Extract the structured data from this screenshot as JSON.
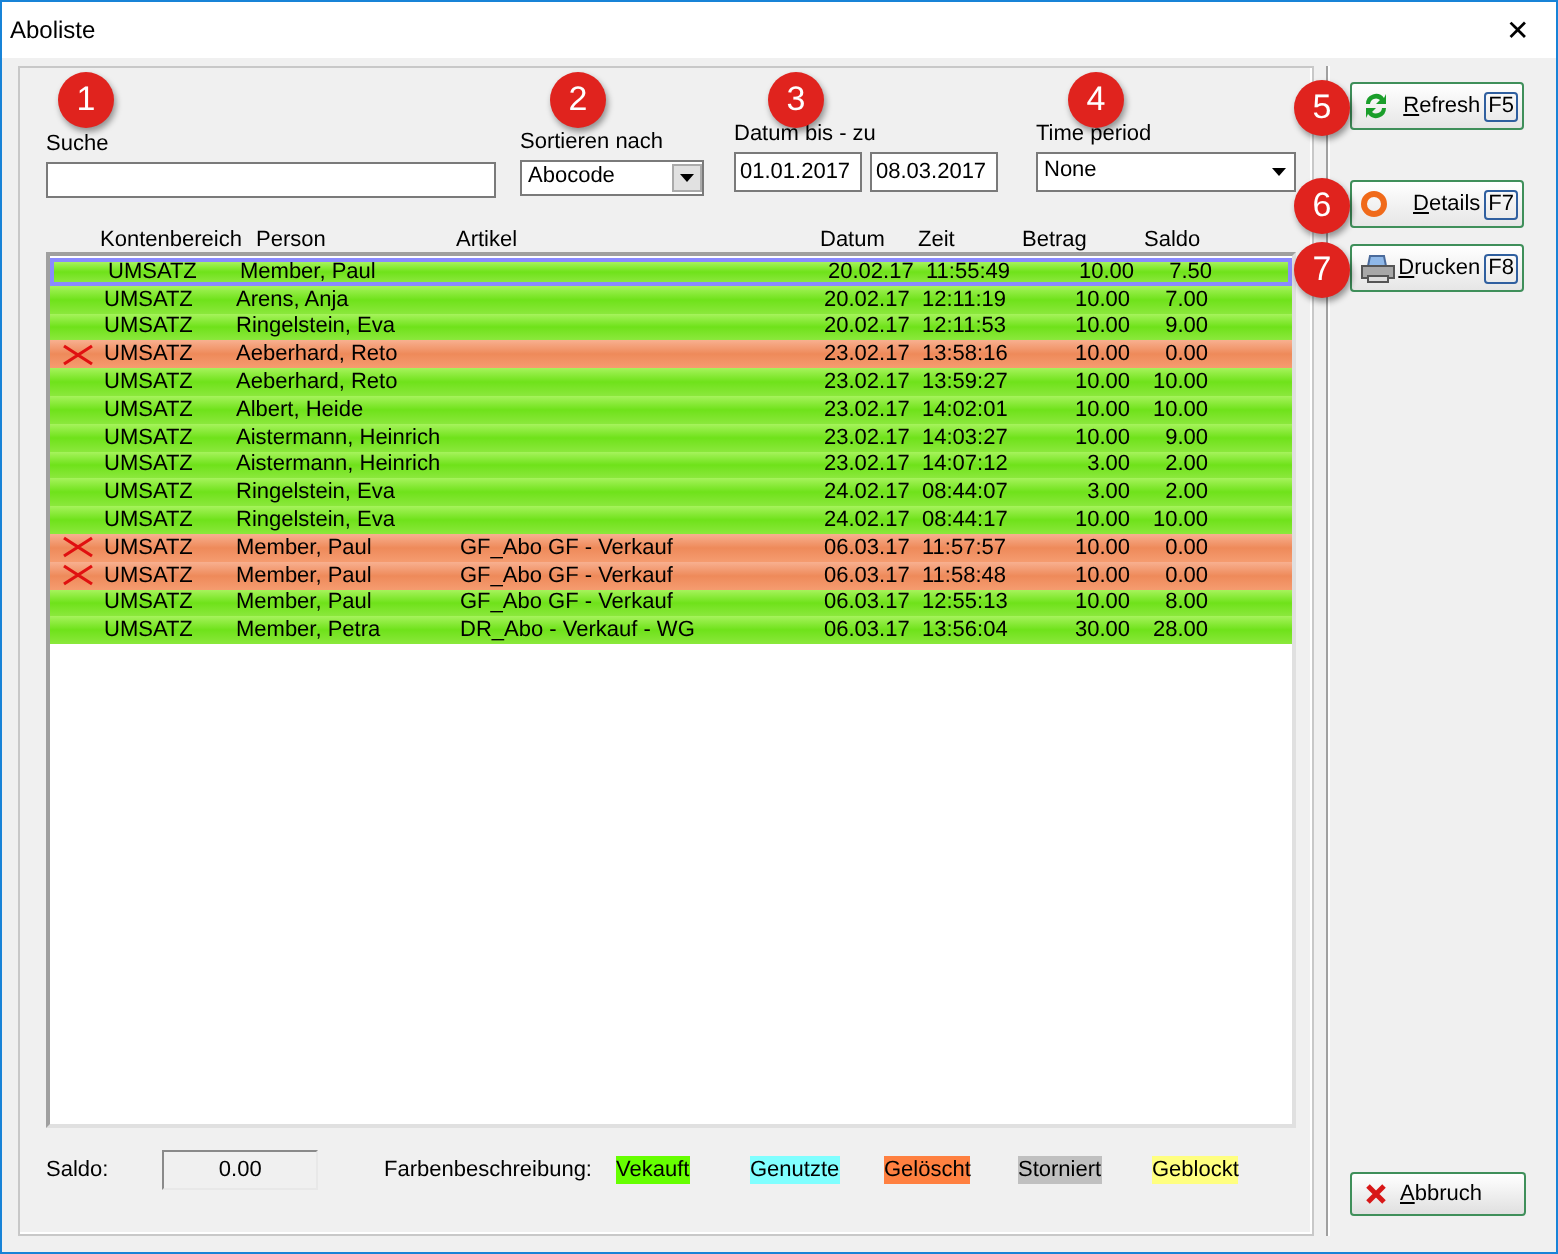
{
  "window": {
    "title": "Aboliste",
    "close": "✕"
  },
  "badges": [
    "1",
    "2",
    "3",
    "4",
    "5",
    "6",
    "7"
  ],
  "search": {
    "label": "Suche"
  },
  "sort": {
    "label": "Sortieren nach",
    "value": "Abocode"
  },
  "date_range": {
    "label": "Datum bis - zu",
    "from": "01.01.2017",
    "to": "08.03.2017"
  },
  "time_period": {
    "label": "Time period",
    "value": "None"
  },
  "table": {
    "columns": [
      "Kontenbereich",
      "Person",
      "Artikel",
      "Datum",
      "Zeit",
      "Betrag",
      "Saldo"
    ],
    "rows": [
      {
        "kind": "sold",
        "selected": true,
        "cells": [
          "UMSATZ",
          "Member, Paul",
          "",
          "20.02.17",
          "11:55:49",
          "10.00",
          "7.50"
        ]
      },
      {
        "kind": "sold",
        "selected": false,
        "cells": [
          "UMSATZ",
          "Arens, Anja",
          "",
          "20.02.17",
          "12:11:19",
          "10.00",
          "7.00"
        ]
      },
      {
        "kind": "sold",
        "selected": false,
        "cells": [
          "UMSATZ",
          "Ringelstein, Eva",
          "",
          "20.02.17",
          "12:11:53",
          "10.00",
          "9.00"
        ]
      },
      {
        "kind": "deleted",
        "selected": false,
        "cells": [
          "UMSATZ",
          "Aeberhard, Reto",
          "",
          "23.02.17",
          "13:58:16",
          "10.00",
          "0.00"
        ]
      },
      {
        "kind": "sold",
        "selected": false,
        "cells": [
          "UMSATZ",
          "Aeberhard, Reto",
          "",
          "23.02.17",
          "13:59:27",
          "10.00",
          "10.00"
        ]
      },
      {
        "kind": "sold",
        "selected": false,
        "cells": [
          "UMSATZ",
          "Albert, Heide",
          "",
          "23.02.17",
          "14:02:01",
          "10.00",
          "10.00"
        ]
      },
      {
        "kind": "sold",
        "selected": false,
        "cells": [
          "UMSATZ",
          "Aistermann, Heinrich",
          "",
          "23.02.17",
          "14:03:27",
          "10.00",
          "9.00"
        ]
      },
      {
        "kind": "sold",
        "selected": false,
        "cells": [
          "UMSATZ",
          "Aistermann, Heinrich",
          "",
          "23.02.17",
          "14:07:12",
          "3.00",
          "2.00"
        ]
      },
      {
        "kind": "sold",
        "selected": false,
        "cells": [
          "UMSATZ",
          "Ringelstein, Eva",
          "",
          "24.02.17",
          "08:44:07",
          "3.00",
          "2.00"
        ]
      },
      {
        "kind": "sold",
        "selected": false,
        "cells": [
          "UMSATZ",
          "Ringelstein, Eva",
          "",
          "24.02.17",
          "08:44:17",
          "10.00",
          "10.00"
        ]
      },
      {
        "kind": "deleted",
        "selected": false,
        "cells": [
          "UMSATZ",
          "Member, Paul",
          "GF_Abo GF - Verkauf",
          "06.03.17",
          "11:57:57",
          "10.00",
          "0.00"
        ]
      },
      {
        "kind": "deleted",
        "selected": false,
        "cells": [
          "UMSATZ",
          "Member, Paul",
          "GF_Abo GF - Verkauf",
          "06.03.17",
          "11:58:48",
          "10.00",
          "0.00"
        ]
      },
      {
        "kind": "sold",
        "selected": false,
        "cells": [
          "UMSATZ",
          "Member, Paul",
          "GF_Abo GF - Verkauf",
          "06.03.17",
          "12:55:13",
          "10.00",
          "8.00"
        ]
      },
      {
        "kind": "sold",
        "selected": false,
        "cells": [
          "UMSATZ",
          "Member, Petra",
          "DR_Abo - Verkauf - WG",
          "06.03.17",
          "13:56:04",
          "30.00",
          "28.00"
        ]
      }
    ]
  },
  "saldo": {
    "label": "Saldo:",
    "value": "0.00"
  },
  "legend": {
    "label": "Farbenbeschreibung:",
    "items": [
      {
        "text": "Vekauft",
        "color": "#66ff00"
      },
      {
        "text": "Genutzte",
        "color": "#80ffff"
      },
      {
        "text": "Gelöscht",
        "color": "#ff8040"
      },
      {
        "text": "Storniert",
        "color": "#c0c0c0"
      },
      {
        "text": "Geblockt",
        "color": "#ffff80"
      }
    ]
  },
  "buttons": [
    {
      "kind": "refresh",
      "label": "Refresh",
      "key": "F5"
    },
    {
      "kind": "details",
      "label": "Details",
      "key": "F7"
    },
    {
      "kind": "print",
      "label": "Drucken",
      "key": "F8"
    }
  ],
  "cancel": {
    "label": "Abbruch"
  }
}
